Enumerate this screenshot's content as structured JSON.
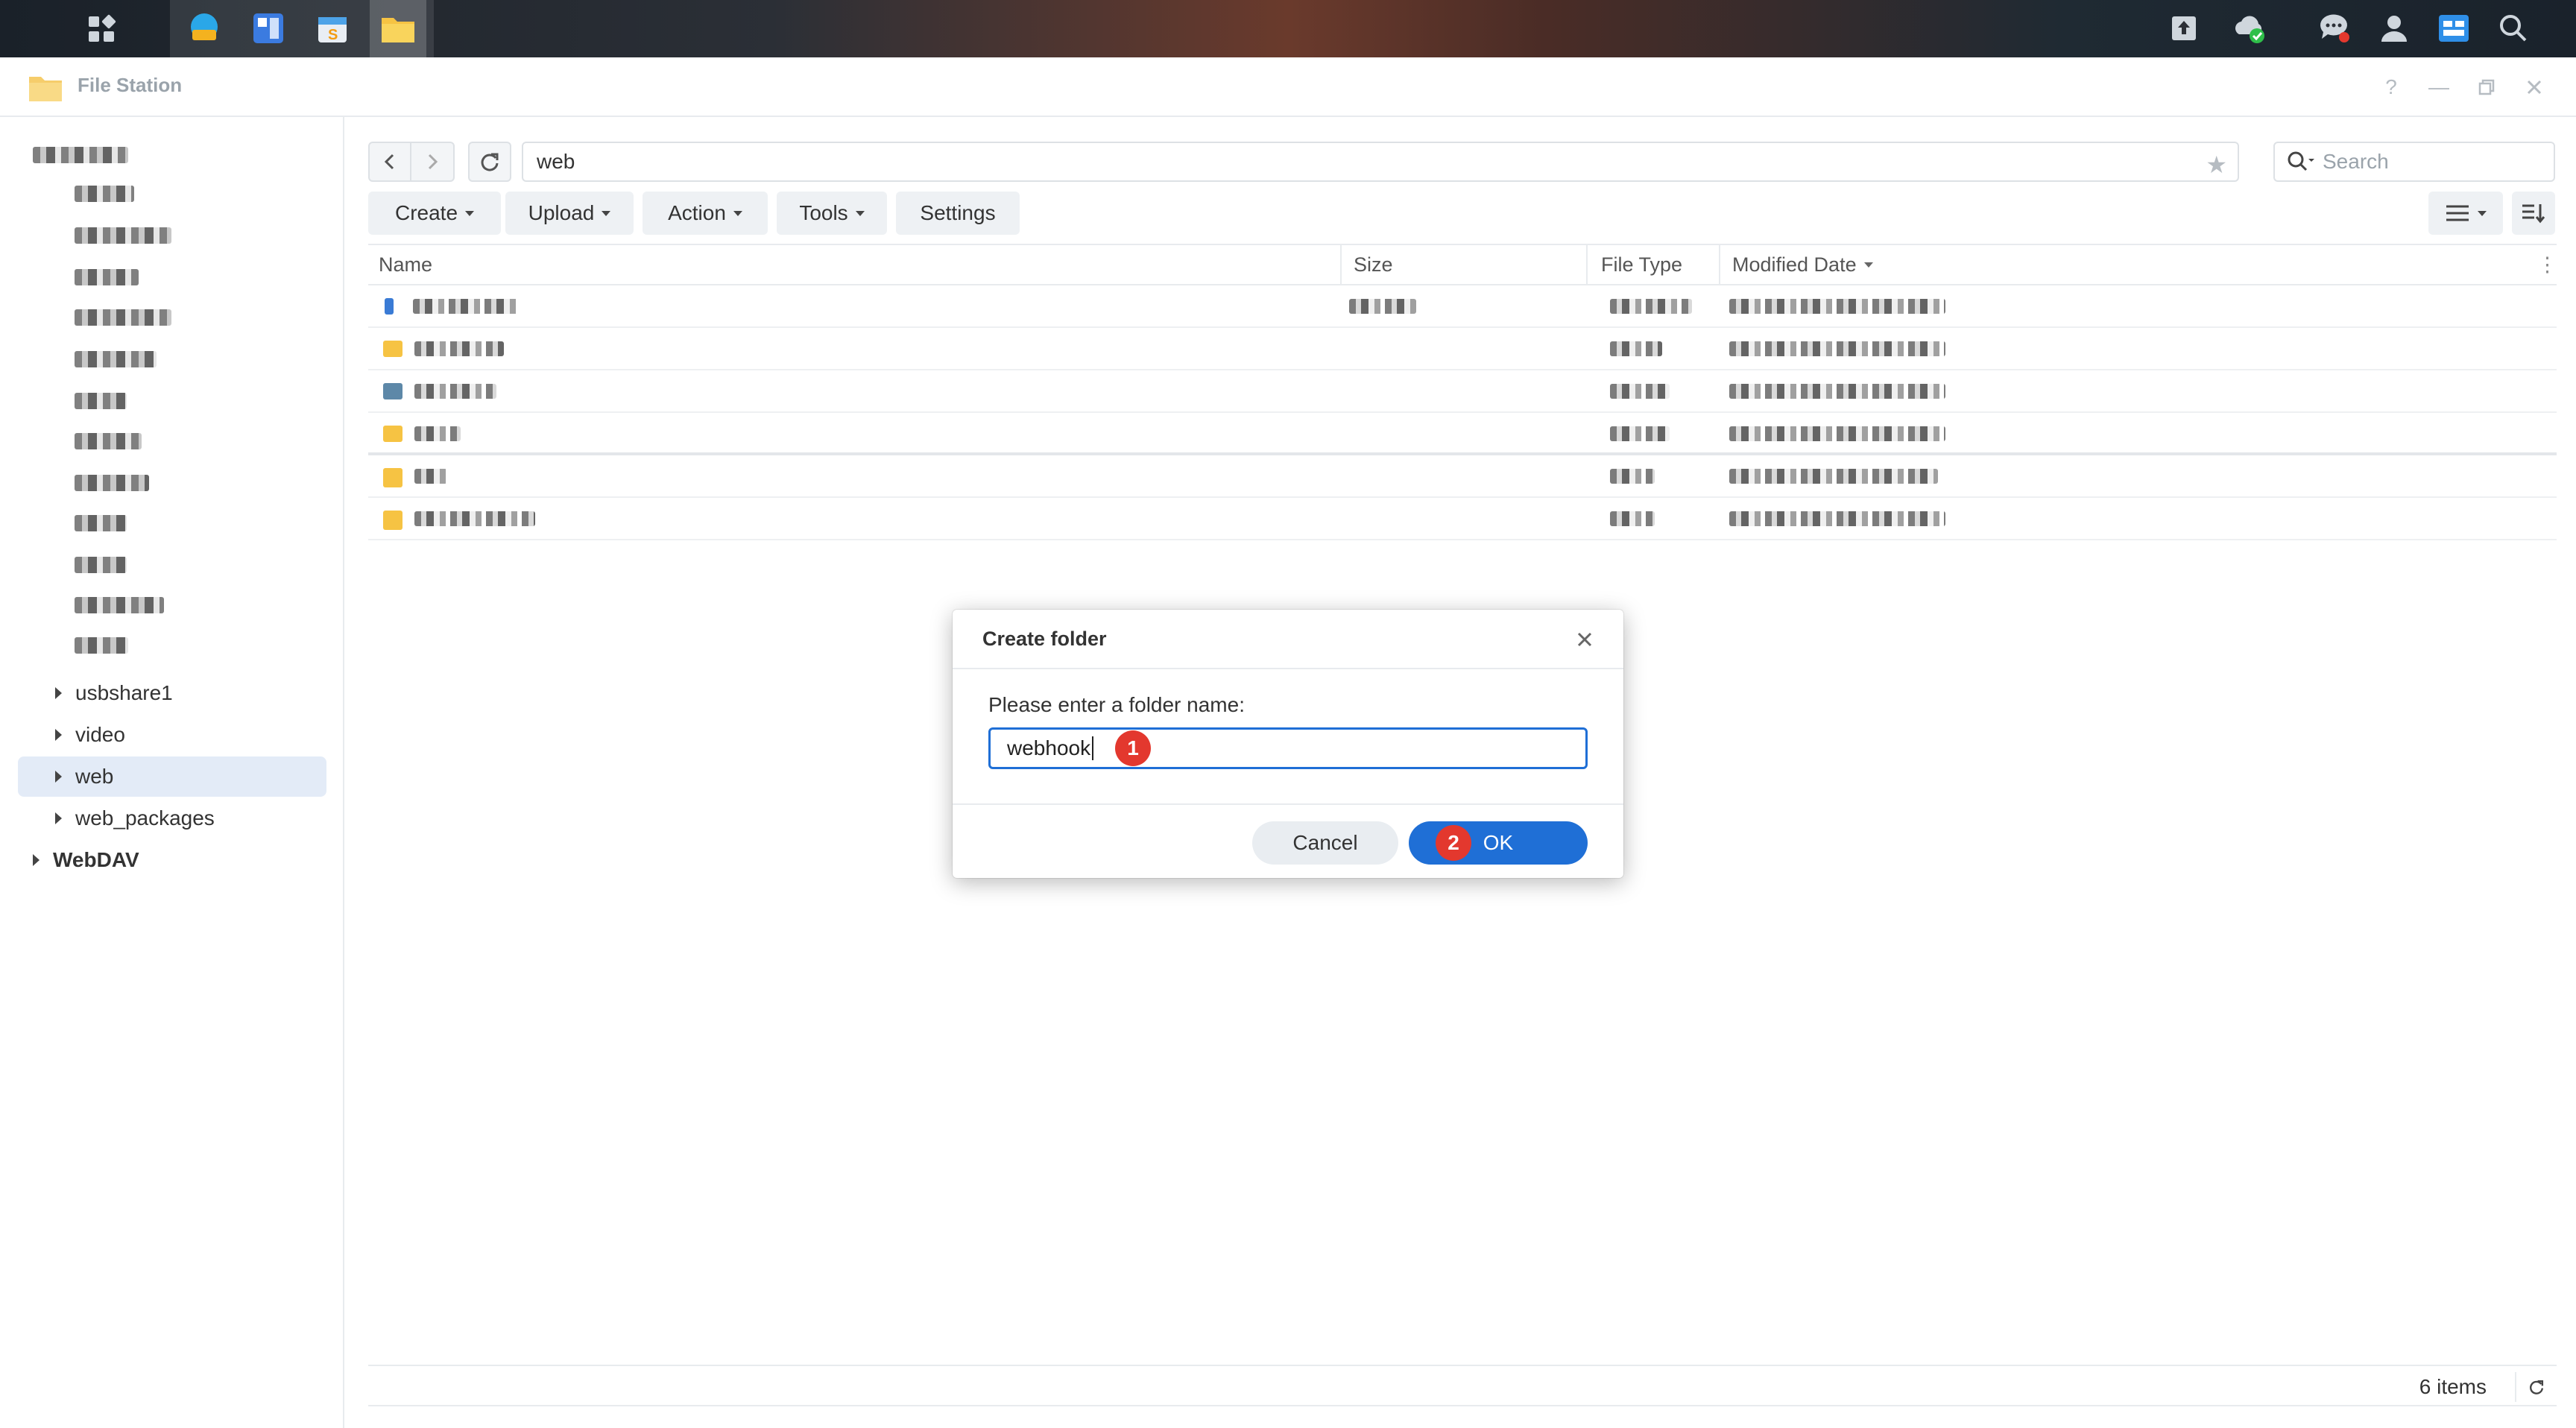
{
  "window": {
    "title": "File Station"
  },
  "sidebar": {
    "items": [
      {
        "label": "usbshare1",
        "selected": false
      },
      {
        "label": "video",
        "selected": false
      },
      {
        "label": "web",
        "selected": true
      },
      {
        "label": "web_packages",
        "selected": false
      }
    ],
    "root_item": "WebDAV"
  },
  "toolbar": {
    "path": "web",
    "search_placeholder": "Search",
    "buttons": [
      "Create",
      "Upload",
      "Action",
      "Tools",
      "Settings"
    ]
  },
  "file_list": {
    "columns": [
      "Name",
      "Size",
      "File Type",
      "Modified Date"
    ],
    "rows": [
      {
        "icon": "blue-file-icon"
      },
      {
        "icon": "folder-icon"
      },
      {
        "icon": "shared-folder-icon"
      },
      {
        "icon": "folder-icon"
      },
      {
        "icon": "folder-icon"
      },
      {
        "icon": "folder-icon"
      }
    ]
  },
  "status": {
    "item_count": "6 items"
  },
  "dialog": {
    "title": "Create folder",
    "label": "Please enter a folder name:",
    "input_value": "webhook",
    "cancel_label": "Cancel",
    "ok_label": "OK",
    "badge_1": "1",
    "badge_2": "2"
  },
  "colors": {
    "accent": "#1f6fd6",
    "badge": "#e3382e",
    "selection": "#e3ebf7"
  }
}
